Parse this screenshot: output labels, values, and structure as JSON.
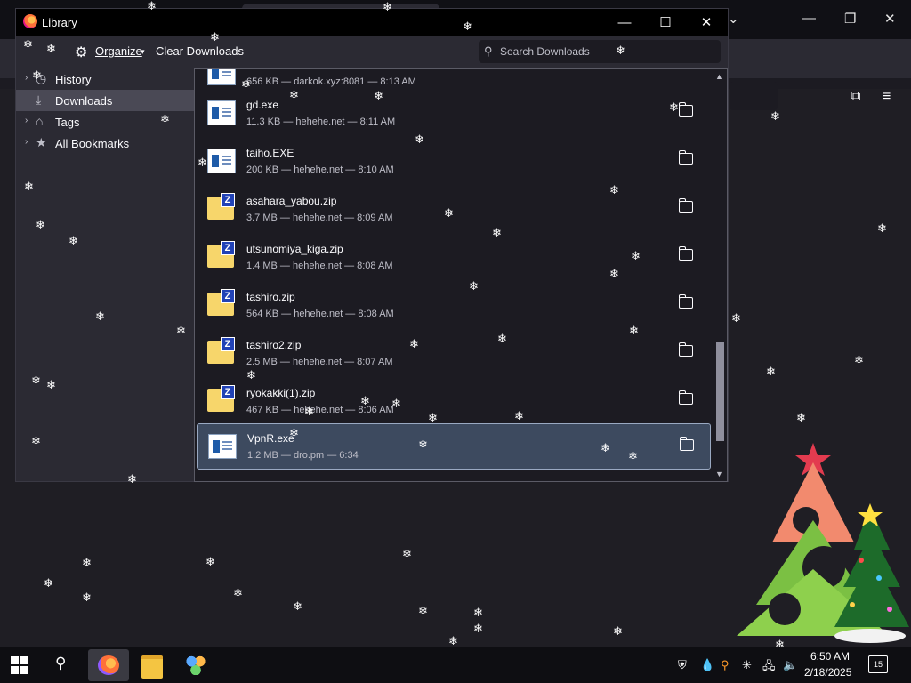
{
  "window": {
    "title": "Library",
    "minimize_glyph": "—",
    "maximize_glyph": "☐",
    "close_glyph": "✕"
  },
  "toolbar": {
    "organize_label": "Organize",
    "clear_label": "Clear Downloads",
    "search_placeholder": "Search Downloads"
  },
  "sidebar": {
    "items": [
      {
        "label": "History",
        "icon": "history-icon"
      },
      {
        "label": "Downloads",
        "icon": "download-icon"
      },
      {
        "label": "Tags",
        "icon": "tag-icon"
      },
      {
        "label": "All Bookmarks",
        "icon": "star-icon"
      }
    ]
  },
  "downloads": [
    {
      "name": "",
      "meta": "656 KB — darkok.xyz:8081 — 8:13 AM",
      "type": "exe"
    },
    {
      "name": "gd.exe",
      "meta": "11.3 KB — hehehe.net — 8:11 AM",
      "type": "exe"
    },
    {
      "name": "taiho.EXE",
      "meta": "200 KB — hehehe.net — 8:10 AM",
      "type": "exe"
    },
    {
      "name": "asahara_yabou.zip",
      "meta": "3.7 MB — hehehe.net — 8:09 AM",
      "type": "zip"
    },
    {
      "name": "utsunomiya_kiga.zip",
      "meta": "1.4 MB — hehehe.net — 8:08 AM",
      "type": "zip"
    },
    {
      "name": "tashiro.zip",
      "meta": "564 KB — hehehe.net — 8:08 AM",
      "type": "zip"
    },
    {
      "name": "tashiro2.zip",
      "meta": "2.5 MB — hehehe.net — 8:07 AM",
      "type": "zip"
    },
    {
      "name": "ryokakki(1).zip",
      "meta": "467 KB — hehehe.net — 8:06 AM",
      "type": "zip"
    },
    {
      "name": "VpnR.exe",
      "meta": "1.2 MB — dro.pm — 6:34",
      "type": "exe"
    }
  ],
  "taskbar": {
    "time": "6:50 AM",
    "date": "2/18/2025",
    "notification_count": "15",
    "apps": [
      "firefox",
      "file-explorer",
      "network-app"
    ]
  },
  "background": {
    "min_glyph": "—",
    "max_glyph": "❐",
    "close_glyph": "✕"
  }
}
